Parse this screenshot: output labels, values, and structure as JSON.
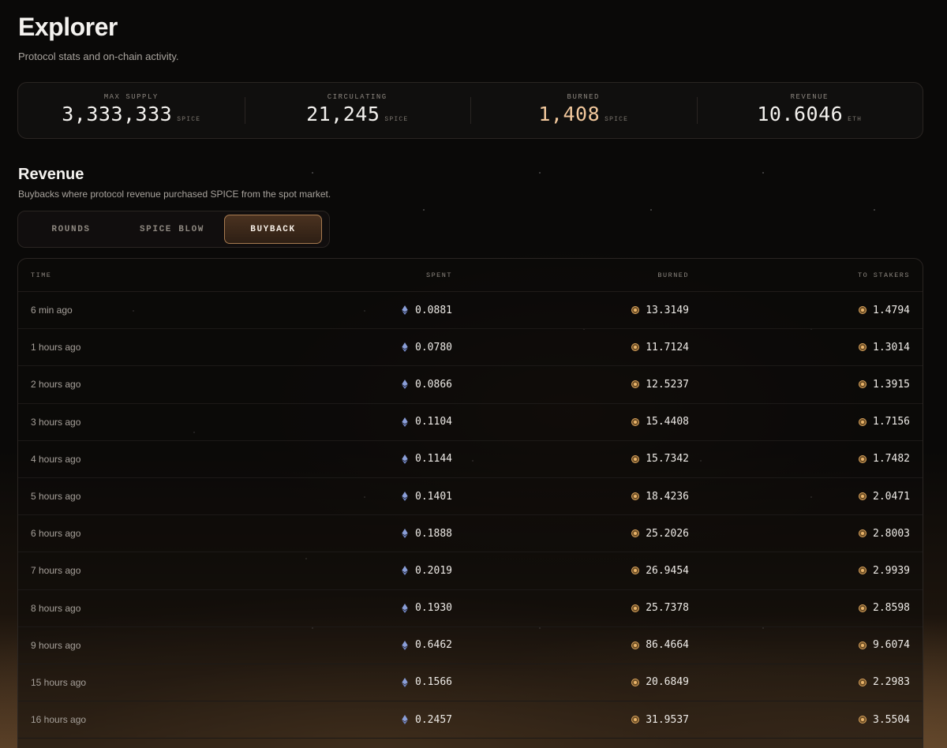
{
  "header": {
    "title": "Explorer",
    "subtitle": "Protocol stats and on-chain activity."
  },
  "stats": [
    {
      "label": "MAX SUPPLY",
      "value": "3,333,333",
      "unit": "SPICE"
    },
    {
      "label": "CIRCULATING",
      "value": "21,245",
      "unit": "SPICE"
    },
    {
      "label": "BURNED",
      "value": "1,408",
      "unit": "SPICE"
    },
    {
      "label": "REVENUE",
      "value": "10.6046",
      "unit": "ETH"
    }
  ],
  "colors": {
    "accent": "#f1c79c",
    "tab_active_border": "#a77a50"
  },
  "revenue": {
    "title": "Revenue",
    "subtitle": "Buybacks where protocol revenue purchased SPICE from the spot market."
  },
  "tabs": [
    {
      "label": "ROUNDS",
      "active": false
    },
    {
      "label": "SPICE BLOW",
      "active": false
    },
    {
      "label": "BUYBACK",
      "active": true
    }
  ],
  "table": {
    "headers": {
      "time": "TIME",
      "spent": "SPENT",
      "burned": "BURNED",
      "stakers": "TO STAKERS"
    },
    "rows": [
      {
        "time": "6 min ago",
        "spent": "0.0881",
        "burned": "13.3149",
        "stakers": "1.4794"
      },
      {
        "time": "1 hours ago",
        "spent": "0.0780",
        "burned": "11.7124",
        "stakers": "1.3014"
      },
      {
        "time": "2 hours ago",
        "spent": "0.0866",
        "burned": "12.5237",
        "stakers": "1.3915"
      },
      {
        "time": "3 hours ago",
        "spent": "0.1104",
        "burned": "15.4408",
        "stakers": "1.7156"
      },
      {
        "time": "4 hours ago",
        "spent": "0.1144",
        "burned": "15.7342",
        "stakers": "1.7482"
      },
      {
        "time": "5 hours ago",
        "spent": "0.1401",
        "burned": "18.4236",
        "stakers": "2.0471"
      },
      {
        "time": "6 hours ago",
        "spent": "0.1888",
        "burned": "25.2026",
        "stakers": "2.8003"
      },
      {
        "time": "7 hours ago",
        "spent": "0.2019",
        "burned": "26.9454",
        "stakers": "2.9939"
      },
      {
        "time": "8 hours ago",
        "spent": "0.1930",
        "burned": "25.7378",
        "stakers": "2.8598"
      },
      {
        "time": "9 hours ago",
        "spent": "0.6462",
        "burned": "86.4664",
        "stakers": "9.6074"
      },
      {
        "time": "15 hours ago",
        "spent": "0.1566",
        "burned": "20.6849",
        "stakers": "2.2983"
      },
      {
        "time": "16 hours ago",
        "spent": "0.2457",
        "burned": "31.9537",
        "stakers": "3.5504"
      }
    ]
  }
}
